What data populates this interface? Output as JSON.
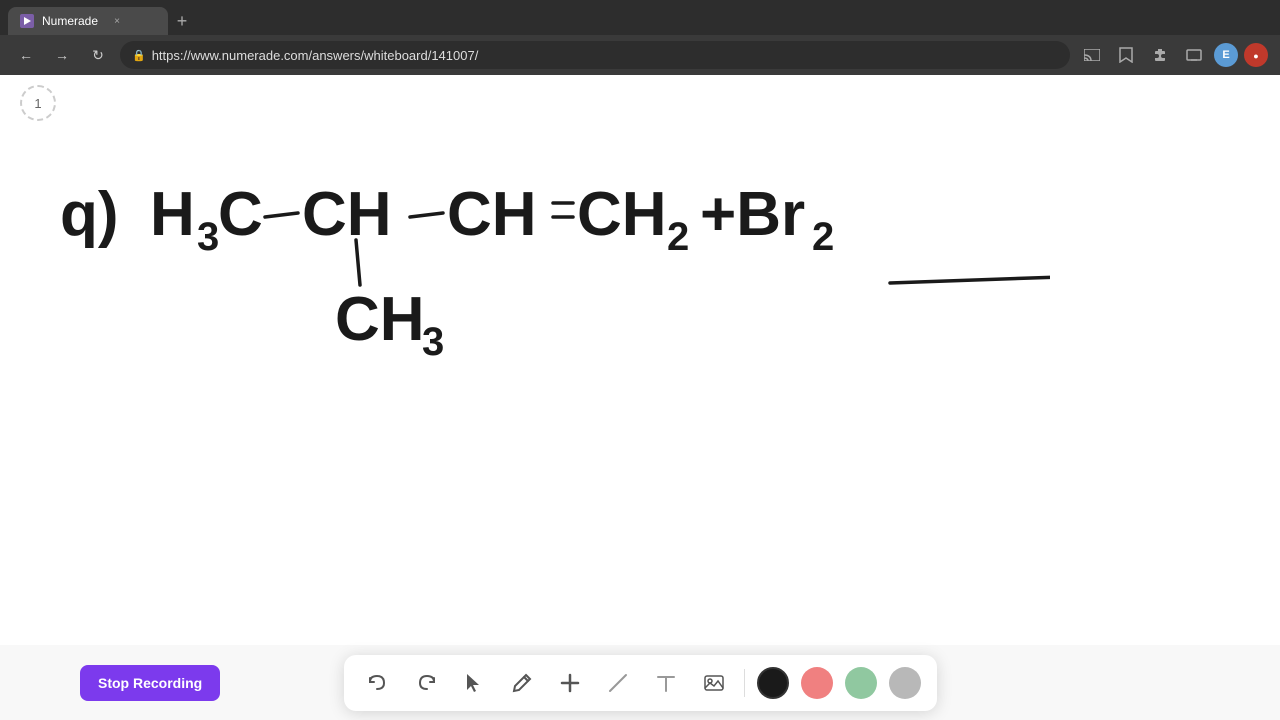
{
  "browser": {
    "tab_label": "Numerade",
    "tab_close": "×",
    "new_tab": "+",
    "url": "https://www.numerade.com/answers/whiteboard/141007/",
    "nav": {
      "back": "←",
      "forward": "→",
      "reload": "↻"
    },
    "toolbar_icons": {
      "cast": "📺",
      "bookmark": "☆",
      "extensions": "🧩",
      "screen": "🖥"
    },
    "profile_e": "E",
    "profile_red": "●"
  },
  "page": {
    "page_number": "1",
    "equation_alt": "Chemical equation: q) H3C-CH-CH=CH2 + Br2 with CH3 substituent"
  },
  "toolbar": {
    "stop_recording": "Stop Recording",
    "undo_icon": "↺",
    "redo_icon": "↻",
    "cursor_icon": "cursor",
    "pen_icon": "pen",
    "plus_icon": "+",
    "line_icon": "line",
    "text_icon": "T",
    "image_icon": "image",
    "colors": {
      "black": "#1a1a1a",
      "pink": "#f08080",
      "mint": "#90c8a0",
      "gray": "#b0b0b0"
    }
  }
}
